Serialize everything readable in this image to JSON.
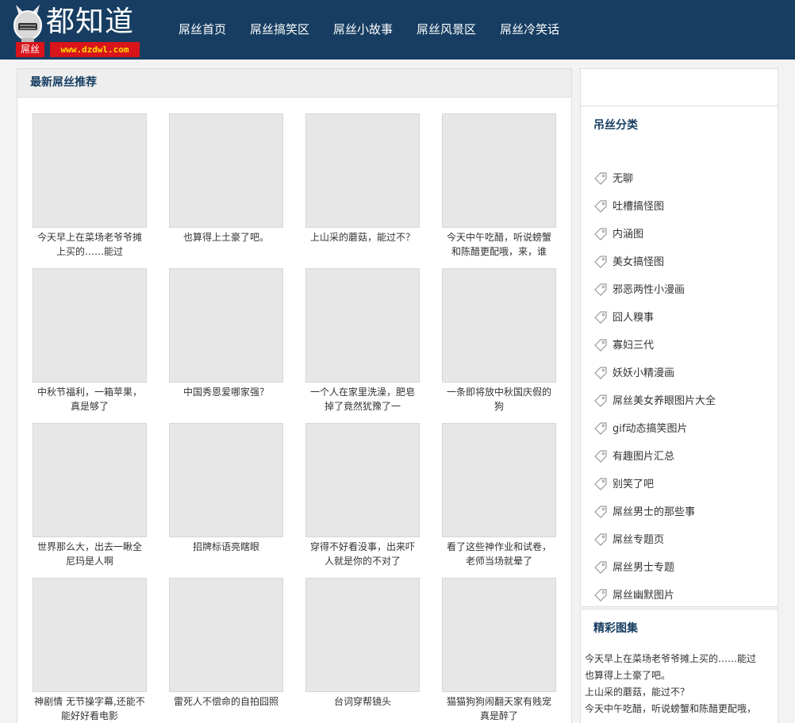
{
  "header": {
    "logo_title": "都知道",
    "logo_badge": "屌丝",
    "logo_url": "www.dzdwl.com",
    "nav": [
      "屌丝首页",
      "屌丝搞笑区",
      "屌丝小故事",
      "屌丝风景区",
      "屌丝冷笑话"
    ]
  },
  "main": {
    "title": "最新屌丝推荐",
    "items": [
      "今天早上在菜场老爷爷摊上买的……能过",
      "也算得上土豪了吧。",
      "上山采的蘑菇，能过不？",
      "今天中午吃醋，听说螃蟹和陈醋更配哦，来，谁",
      "中秋节福利，一箱苹果，真是够了",
      "中国秀恩爱哪家强？",
      "一个人在家里洗澡，肥皂掉了竟然犹豫了一",
      "一条即将放中秋国庆假的狗",
      "世界那么大，出去一瞅全尼玛是人啊",
      "招牌标语亮瞎眼",
      "穿得不好看没事，出来吓人就是你的不对了",
      "看了这些神作业和试卷，老师当场就晕了",
      "神剧情 无节操字幕,还能不能好好看电影",
      "雷死人不偿命的自拍囧照",
      "台词穿帮镜头",
      "猫猫狗狗闹翻天家有贱宠真是醉了"
    ]
  },
  "sidebar": {
    "category_title": "吊丝分类",
    "categories": [
      "无聊",
      "吐槽搞怪图",
      "内涵图",
      "美女搞怪图",
      "邪恶两性小漫画",
      "囧人糗事",
      "寡妇三代",
      "妖妖小精漫画",
      "屌丝美女养眼图片大全",
      "gif动态搞笑图片",
      "有趣图片汇总",
      "别笑了吧",
      "屌丝男士的那些事",
      "屌丝专题页",
      "屌丝男士专题",
      "屌丝幽默图片"
    ],
    "gallery_title": "精彩图集",
    "gallery_items": [
      "今天早上在菜场老爷爷摊上买的……能过",
      "也算得上土豪了吧。",
      "上山采的蘑菇，能过不？",
      "今天中午吃醋，听说螃蟹和陈醋更配哦，"
    ]
  },
  "colors": {
    "header_bg": "#173e62",
    "accent_text": "#173e62",
    "badge_red": "#d9141b",
    "url_yellow": "#ffde00"
  }
}
